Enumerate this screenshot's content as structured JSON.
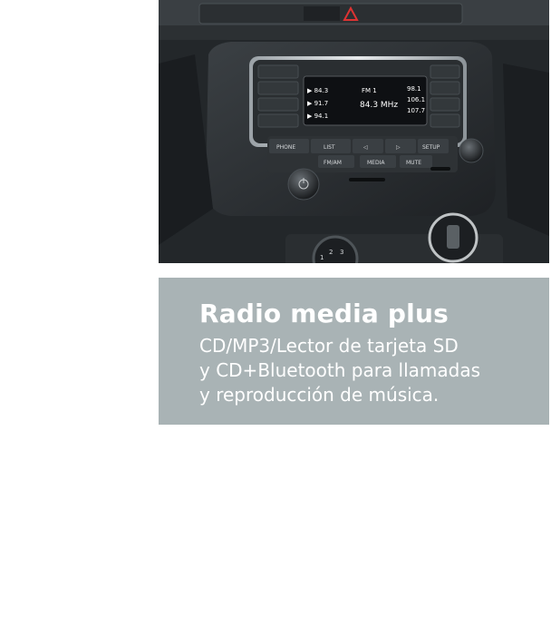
{
  "panel": {
    "title": "Radio media plus",
    "lines": [
      "CD/MP3/Lector de tarjeta SD",
      "y CD+Bluetooth para llamadas",
      "y reproducción de música."
    ]
  },
  "radio": {
    "display": {
      "presets_left": [
        "▶ 84.3",
        "▶ 91.7",
        "▶ 94.1"
      ],
      "band": "FM 1",
      "frequency": "84.3 MHz",
      "presets_right": [
        "98.1",
        "106.1",
        "107.7"
      ]
    },
    "buttons": {
      "phone": "PHONE",
      "list": "LIST",
      "prev": "◁",
      "next": "▷",
      "fm_am": "FM/AM",
      "media": "MEDIA",
      "mute": "MUTE",
      "setup": "SETUP"
    },
    "dial_numbers": [
      "1",
      "2",
      "3"
    ]
  },
  "colors": {
    "panel_bg": "#a9b3b5",
    "display_text": "#ffffff",
    "display_bg": "#0e1013"
  }
}
